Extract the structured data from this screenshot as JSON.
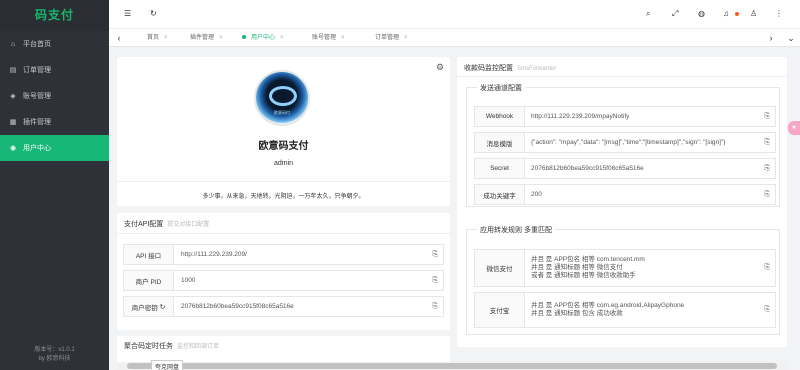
{
  "app": {
    "logo": "码支付"
  },
  "sidebar": {
    "items": [
      {
        "label": "平台首页",
        "icon": "home-icon"
      },
      {
        "label": "订单管理",
        "icon": "clipboard-icon"
      },
      {
        "label": "账号管理",
        "icon": "shield-icon"
      },
      {
        "label": "插件管理",
        "icon": "grid-icon"
      },
      {
        "label": "用户中心",
        "icon": "user-circle-icon",
        "active": true
      }
    ],
    "footer_version": "版本号：v1.0.1",
    "footer_by": "by 欧意科技"
  },
  "tabs": [
    {
      "label": "首页"
    },
    {
      "label": "插件管理"
    },
    {
      "label": "用户中心",
      "active": true
    },
    {
      "label": "账号管理"
    },
    {
      "label": "订单管理"
    }
  ],
  "profile": {
    "avatar_text": "欧意码付",
    "name": "欧意码支付",
    "username": "admin",
    "motto": "多少事，从来急，天地转，光阴迫，一万年太久，只争朝夕。"
  },
  "api_config": {
    "title": "支付API配置",
    "subtitle": "提交对接口配置",
    "rows": [
      {
        "label": "API 接口",
        "value": "http://111.229.239.209/"
      },
      {
        "label": "商户 PID",
        "value": "1000"
      },
      {
        "label": "商户密钥",
        "value": "2076b812b60bea59cc915f08c65a516e"
      }
    ]
  },
  "cron": {
    "title": "聚合码定时任务",
    "subtitle": "监控和回调订单"
  },
  "monitor": {
    "title": "收款码监控配置",
    "subtitle": "SmsForwarder",
    "send_legend": "发送通道配置",
    "send_rows": [
      {
        "label": "Webhook",
        "value": "http://111.229.239.209/mpayNotify"
      },
      {
        "label": "消息模版",
        "value": "{\"action\": \"mpay\",\"data\": \"[msg]\",\"time\":\"[timestamp]\",\"sign\": \"[sign]\"}"
      },
      {
        "label": "Secret",
        "value": "2076b812b60bea59cc915f08c65a516e"
      },
      {
        "label": "成功关键字",
        "value": "200"
      }
    ],
    "rule_legend": "应用转发规则 多重匹配",
    "rule_rows": [
      {
        "label": "微信支付",
        "lines": [
          "并且 是 APP包名 相等 com.tencent.mm",
          "并且 是 通知标题 相等 微信支付",
          "或者 是 通知标题 相等 微信收款助手"
        ]
      },
      {
        "label": "支付宝",
        "lines": [
          "并且 是 APP包名 相等 com.eg.android.AlipayGphone",
          "并且 是 通知标题 包含 成功收款"
        ]
      }
    ]
  },
  "tooltip": "夸克网盘"
}
